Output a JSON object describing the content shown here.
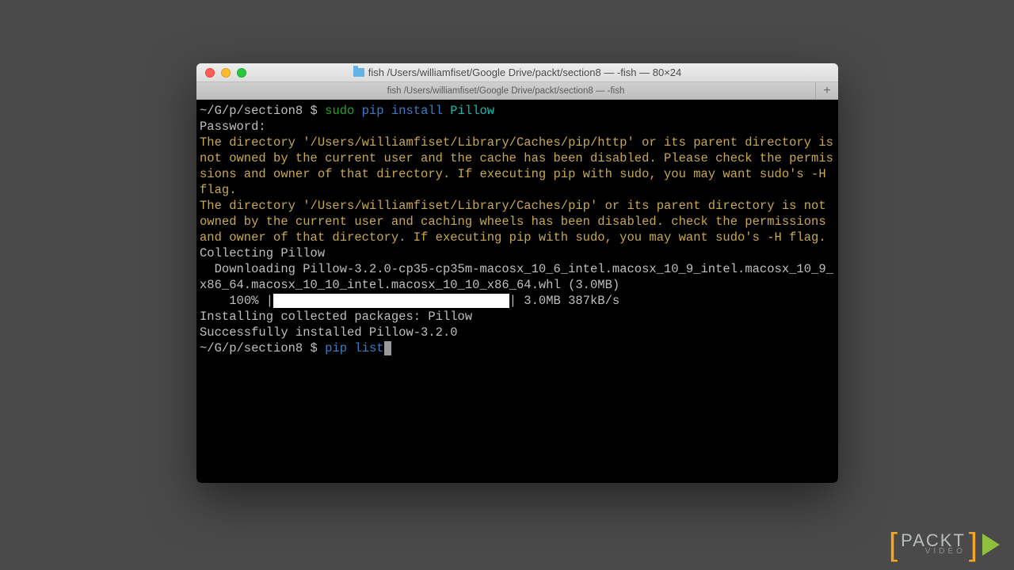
{
  "window": {
    "title": "fish  /Users/williamfiset/Google Drive/packt/section8 — -fish — 80×24",
    "tab_title": "fish  /Users/williamfiset/Google Drive/packt/section8 — -fish",
    "new_tab": "+"
  },
  "term": {
    "prompt1_path": "~/G/p/section8",
    "prompt1_dollar": " $ ",
    "cmd1_sudo": "sudo",
    "cmd1_pip": " pip",
    "cmd1_install": " install",
    "cmd1_arg": " Pillow",
    "passline": "Password:",
    "warn1": "The directory '/Users/williamfiset/Library/Caches/pip/http' or its parent directory is not owned by the current user and the cache has been disabled. Please check the permissions and owner of that directory. If executing pip with sudo, you may want sudo's -H flag.",
    "warn2": "The directory '/Users/williamfiset/Library/Caches/pip' or its parent directory is not owned by the current user and caching wheels has been disabled. check the permissions and owner of that directory. If executing pip with sudo, you may want sudo's -H flag.",
    "collect": "Collecting Pillow",
    "download": "  Downloading Pillow-3.2.0-cp35-cp35m-macosx_10_6_intel.macosx_10_9_intel.macosx_10_9_x86_64.macosx_10_10_intel.macosx_10_10_x86_64.whl (3.0MB)",
    "prog_pct": "    100% |",
    "prog_bar": "████████████████████████████████",
    "prog_tail": "| 3.0MB 387kB/s",
    "installing": "Installing collected packages: Pillow",
    "success": "Successfully installed Pillow-3.2.0",
    "prompt2_path": "~/G/p/section8",
    "prompt2_dollar": " $ ",
    "cmd2_pip": "pip",
    "cmd2_list": " list"
  },
  "watermark": {
    "main": "PACKT",
    "sub": "VIDEO",
    "lbr": "[",
    "rbr": "]"
  }
}
